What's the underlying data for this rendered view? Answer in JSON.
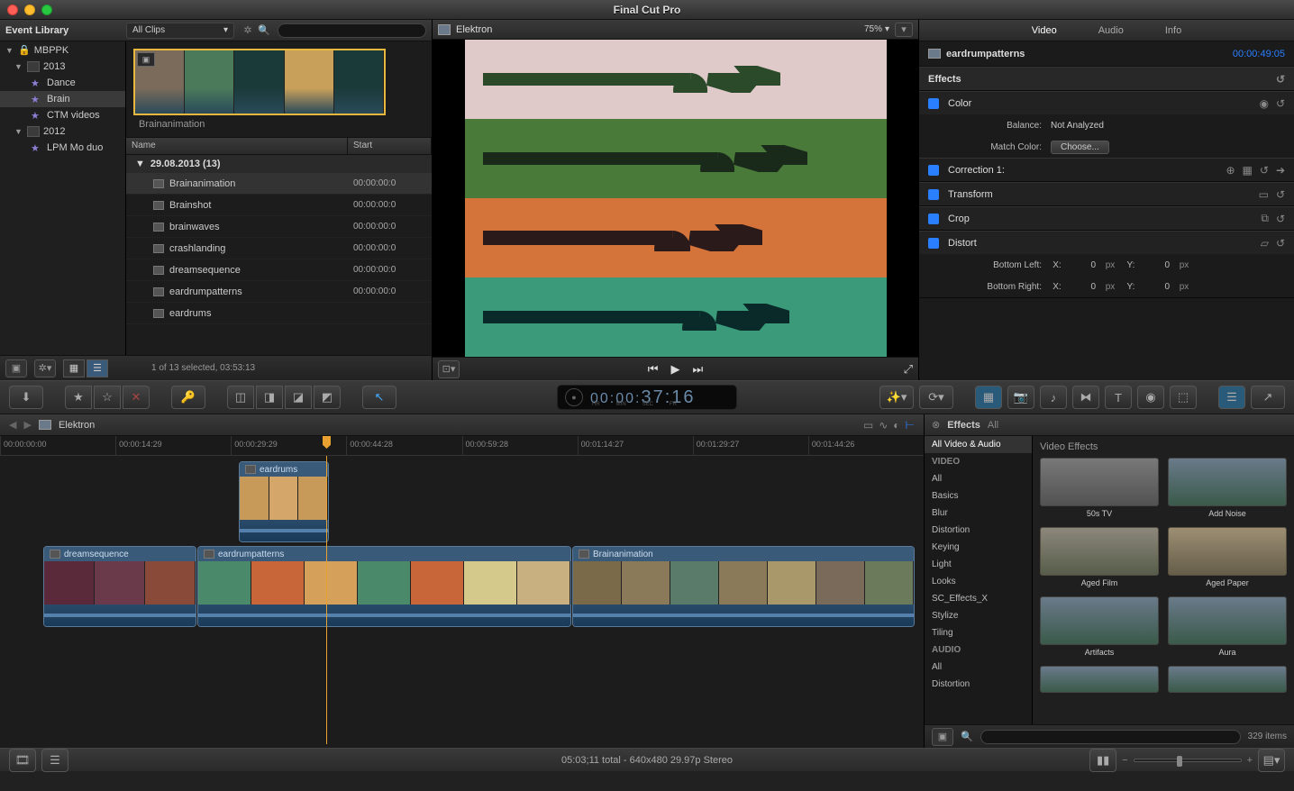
{
  "app": {
    "title": "Final Cut Pro"
  },
  "event_library": {
    "title": "Event Library",
    "clips_filter": "All Clips",
    "search_placeholder": "",
    "tree": {
      "root": "MBPPK",
      "y2013": "2013",
      "y2013_items": [
        "Dance",
        "Brain",
        "CTM videos"
      ],
      "y2012": "2012",
      "y2012_items": [
        "LPM Mo duo"
      ]
    },
    "filmstrip_caption": "Brainanimation",
    "columns": {
      "name": "Name",
      "start": "Start"
    },
    "group": "29.08.2013  (13)",
    "clips": [
      {
        "name": "Brainanimation",
        "start": "00:00:00:0"
      },
      {
        "name": "Brainshot",
        "start": "00:00:00:0"
      },
      {
        "name": "brainwaves",
        "start": "00:00:00:0"
      },
      {
        "name": "crashlanding",
        "start": "00:00:00:0"
      },
      {
        "name": "dreamsequence",
        "start": "00:00:00:0"
      },
      {
        "name": "eardrumpatterns",
        "start": "00:00:00:0"
      },
      {
        "name": "eardrums",
        "start": ""
      }
    ],
    "footer_status": "1 of 13 selected, 03:53:13"
  },
  "viewer": {
    "title": "Elektron",
    "zoom": "75%"
  },
  "inspector": {
    "tabs": [
      "Video",
      "Audio",
      "Info"
    ],
    "clip_name": "eardrumpatterns",
    "timecode": "00:00:49:05",
    "sections": {
      "effects": "Effects",
      "color": "Color",
      "balance_label": "Balance:",
      "balance_value": "Not Analyzed",
      "match_label": "Match Color:",
      "match_btn": "Choose...",
      "correction": "Correction 1:",
      "transform": "Transform",
      "crop": "Crop",
      "distort": "Distort",
      "distort_bl": "Bottom Left:",
      "distort_br": "Bottom Right:",
      "x": "X:",
      "y": "Y:",
      "val0": "0",
      "px": "px"
    }
  },
  "timecode": {
    "small": "00:00:",
    "large": "37:16",
    "labels": [
      "HR",
      "MIN",
      "SEC",
      "FR"
    ]
  },
  "timeline": {
    "title": "Elektron",
    "ticks": [
      "00:00:00:00",
      "00:00:14:29",
      "00:00:29:29",
      "00:00:44:28",
      "00:00:59:28",
      "00:01:14:27",
      "00:01:29:27",
      "00:01:44:26"
    ],
    "clips": {
      "eardrums": "eardrums",
      "dreamsequence": "dreamsequence",
      "eardrumpatterns": "eardrumpatterns",
      "brainanimation": "Brainanimation"
    }
  },
  "effects": {
    "header": "Effects",
    "all": "All",
    "all_video_audio": "All Video & Audio",
    "cat_video": "VIDEO",
    "video_cats": [
      "All",
      "Basics",
      "Blur",
      "Distortion",
      "Keying",
      "Light",
      "Looks",
      "SC_Effects_X",
      "Stylize",
      "Tiling"
    ],
    "cat_audio": "AUDIO",
    "audio_cats": [
      "All",
      "Distortion"
    ],
    "grid_title": "Video Effects",
    "items": [
      "50s TV",
      "Add Noise",
      "Aged Film",
      "Aged Paper",
      "Artifacts",
      "Aura"
    ],
    "count": "329 items"
  },
  "bottom": {
    "status": "05:03;11 total - 640x480 29.97p Stereo"
  }
}
